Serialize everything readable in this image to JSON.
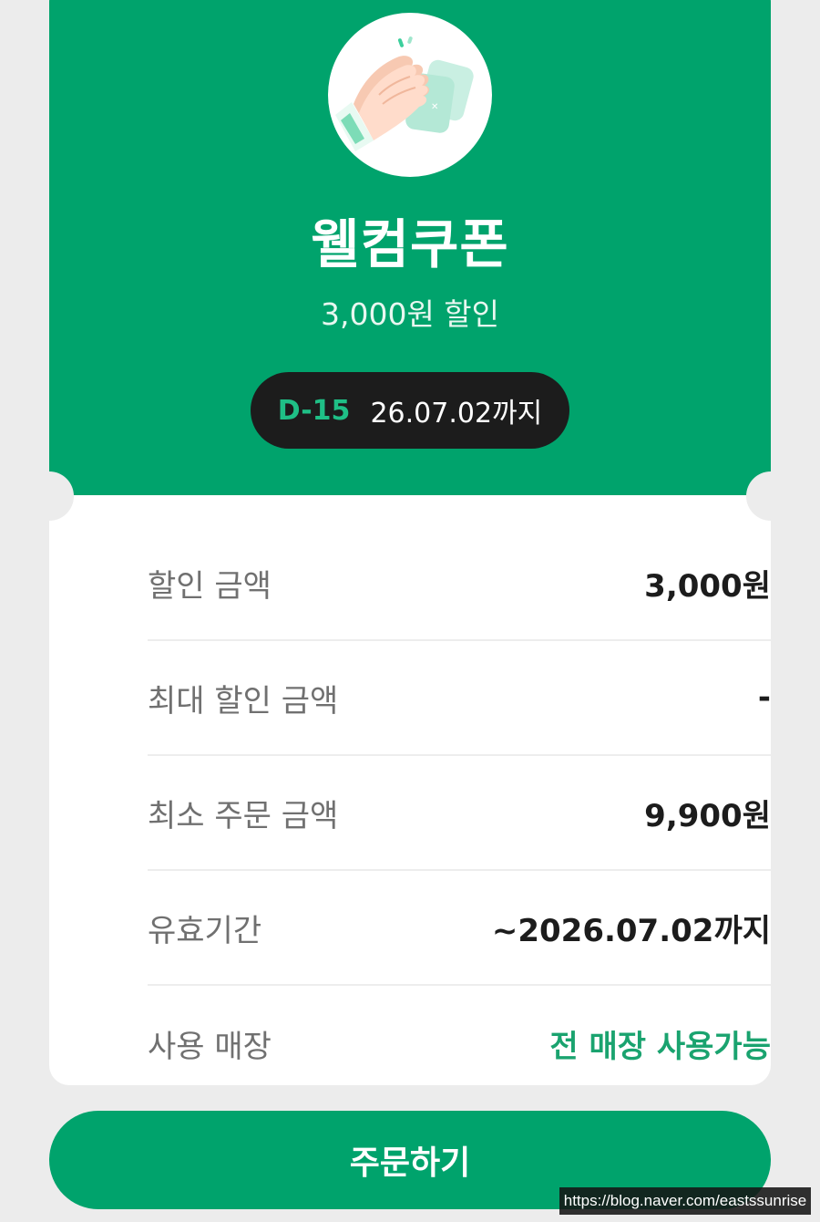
{
  "coupon": {
    "title": "웰컴쿠폰",
    "subtitle": "3,000원 할인",
    "dday": "D-15",
    "expiry": "26.07.02까지",
    "illustration_icon": "clapping-hands-icon"
  },
  "details": [
    {
      "label": "할인 금액",
      "value": "3,000원"
    },
    {
      "label": "최대 할인 금액",
      "value": "-"
    },
    {
      "label": "최소 주문 금액",
      "value": "9,900원"
    },
    {
      "label": "유효기간",
      "value": "~2026.07.02까지"
    },
    {
      "label": "사용 매장",
      "value": "전 매장 사용가능"
    }
  ],
  "order_button": {
    "label": "주문하기"
  },
  "watermark": "https://blog.naver.com/eastssunrise",
  "colors": {
    "brand_green": "#00a36c",
    "accent_text_green": "#1aa36f",
    "dday_green": "#1fbf86",
    "pill_dark": "#1c1c1c",
    "background": "#ececec"
  }
}
